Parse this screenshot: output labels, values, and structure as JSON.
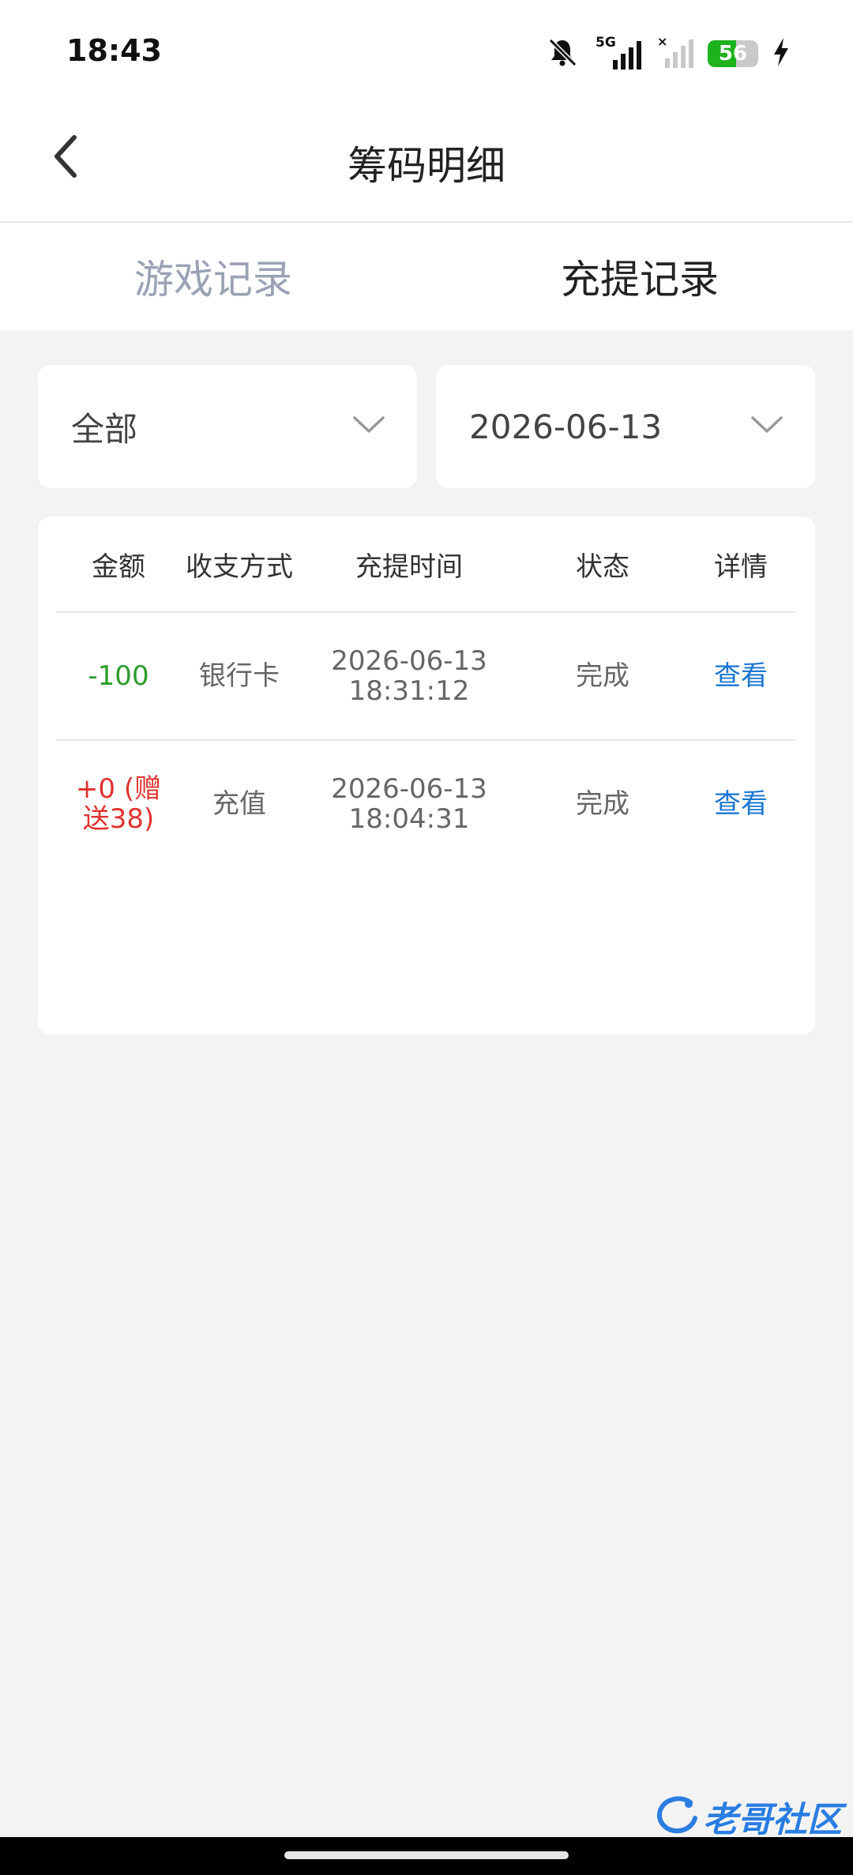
{
  "status_bar": {
    "time": "18:43",
    "network": "5G",
    "battery": "56",
    "battery_level": 0.56,
    "icons": [
      "bell-muted-icon",
      "signal-5g-icon",
      "signal-no-service-icon",
      "battery-icon",
      "charging-bolt-icon"
    ]
  },
  "header": {
    "title": "筹码明细",
    "back_icon": "chevron-left-icon"
  },
  "tabs": [
    {
      "label": "游戏记录",
      "active": false
    },
    {
      "label": "充提记录",
      "active": true
    }
  ],
  "filters": {
    "type": {
      "value": "全部",
      "icon": "chevron-down-icon"
    },
    "date": {
      "value": "2026-06-13",
      "icon": "chevron-down-icon"
    }
  },
  "table": {
    "headers": [
      "金额",
      "收支方式",
      "充提时间",
      "状态",
      "详情"
    ],
    "rows": [
      {
        "amount": "-100",
        "method": "银行卡",
        "date": "2026-06-13",
        "time": "18:31:12",
        "status": "完成",
        "detail": "查看"
      },
      {
        "amount": "+0 (赠送38)",
        "method": "充值",
        "date": "2026-06-13",
        "time": "18:04:31",
        "status": "完成",
        "detail": "查看"
      }
    ]
  },
  "watermark": {
    "text": "老哥社区"
  },
  "colors": {
    "negative_amount": "#2a9d2a",
    "positive_amount": "#e0332f",
    "link": "#1976d2",
    "tab_inactive": "#9aa2b4",
    "background": "#f3f3f3",
    "battery": "#1db31d"
  }
}
